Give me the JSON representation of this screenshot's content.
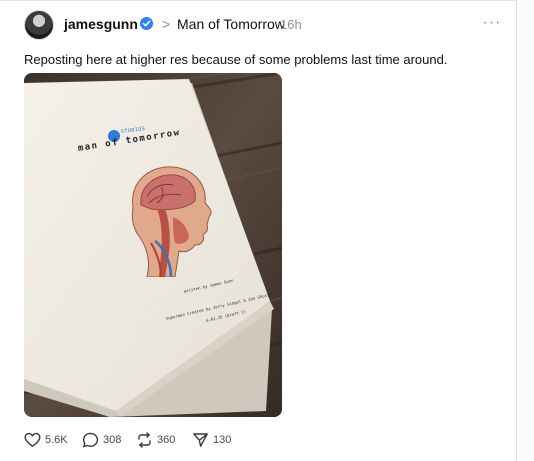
{
  "post": {
    "author": "jamesgunn",
    "topic": "Man of Tomorrow",
    "time": "16h",
    "text": "Reposting here at higher res because of some problems last time around."
  },
  "image": {
    "studio_text": "STUDIOS",
    "book_title": "man of tomorrow",
    "credit_line1": "Written by James Gunn",
    "credit_line2": "Superman Created by Jerry Siegel & Joe Shuster",
    "credit_line3": "6.01.25 (Draft 1)"
  },
  "actions": {
    "likes": "5.6K",
    "replies": "308",
    "reposts": "360",
    "shares": "130"
  },
  "icons": {
    "verified": "verified-badge-icon",
    "more": "more-icon",
    "like": "heart-icon",
    "reply": "reply-icon",
    "repost": "repost-icon",
    "share": "share-icon"
  },
  "colors": {
    "verified": "#2f81f7",
    "text": "#101010",
    "muted": "#8f8f8f"
  }
}
